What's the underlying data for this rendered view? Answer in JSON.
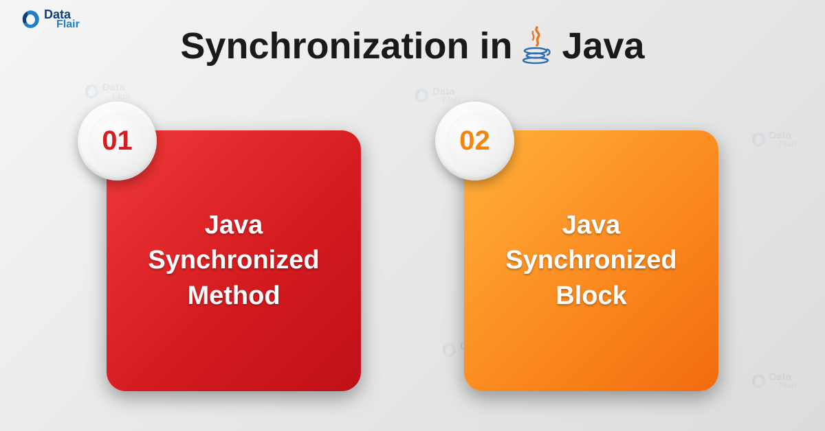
{
  "brand": {
    "primary": "Data",
    "secondary": "Flair"
  },
  "title": {
    "prefix": "Synchronization in ",
    "suffix": "Java"
  },
  "cards": [
    {
      "number": "01",
      "line1": "Java",
      "line2": "Synchronized",
      "line3": "Method",
      "color": "red"
    },
    {
      "number": "02",
      "line1": "Java",
      "line2": "Synchronized",
      "line3": "Block",
      "color": "orange"
    }
  ],
  "colors": {
    "red_gradient": "#d51c20",
    "orange_gradient": "#f5840d",
    "brand_dark": "#0a3d7a",
    "brand_light": "#1e7fc4"
  }
}
